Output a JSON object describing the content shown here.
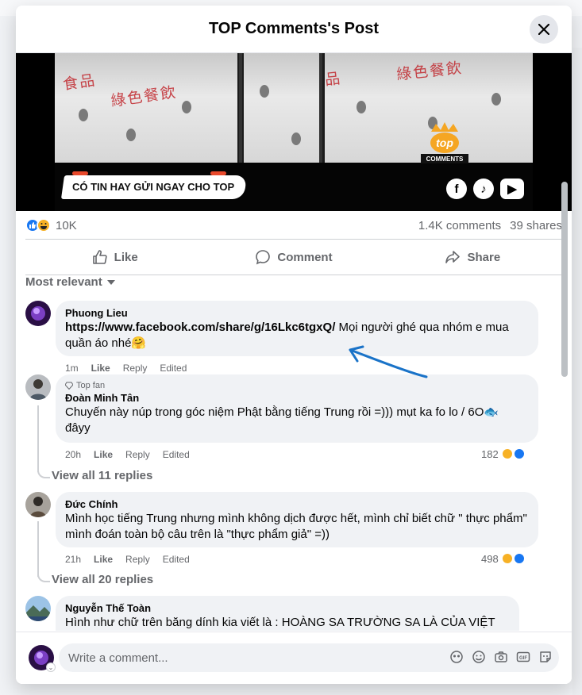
{
  "dialog": {
    "title": "TOP Comments's Post"
  },
  "video": {
    "banner_text": "CÓ TIN HAY GỬI NGAY CHO TOP",
    "overlay_chars": [
      "食品",
      "綠色餐飲",
      "品",
      "綠色餐飲"
    ],
    "logo_text": "COMMENTS",
    "logo_top": "top"
  },
  "stats": {
    "reaction_count": "10K",
    "comments": "1.4K comments",
    "shares": "39 shares"
  },
  "actions": {
    "like": "Like",
    "comment": "Comment",
    "share": "Share"
  },
  "sort": {
    "label": "Most relevant"
  },
  "comments": [
    {
      "name": "Phuong Lieu",
      "link": "https://www.facebook.com/share/g/16Lkc6tgxQ/",
      "text_line1": " Mọi người ghé qua nhóm e mua",
      "text_line2": "quần áo nhé",
      "emoji": "🤗",
      "time": "1m",
      "like": "Like",
      "reply": "Reply",
      "edited": "Edited"
    },
    {
      "badge": "Top fan",
      "name": "Đoàn Minh Tân",
      "text_line1": "Chuyến này núp trong góc niệm Phật bằng tiếng Trung rồi =))) mụt ka fo lo / 6O",
      "emoji": "🐟",
      "text_line2": "đâyy",
      "time": "20h",
      "like": "Like",
      "reply": "Reply",
      "edited": "Edited",
      "react_count": "182",
      "view_replies": "View all 11 replies"
    },
    {
      "name": "Đức Chính",
      "text_line1": "Mình học tiếng Trung nhưng mình không dịch được hết, mình chỉ biết chữ \" thực phẩm\"",
      "text_line2": "mình đoán toàn bộ câu trên là \"thực phẩm giả\" =))",
      "time": "21h",
      "like": "Like",
      "reply": "Reply",
      "edited": "Edited",
      "react_count": "498",
      "view_replies": "View all 20 replies"
    },
    {
      "name": "Nguyễn Thế Toàn",
      "text_line1": "Hình như chữ trên băng dính kia viết là : HOÀNG SA TRƯỜNG SA LÀ CỦA VIỆT NAM."
    }
  ],
  "composer": {
    "placeholder": "Write a comment..."
  },
  "colors": {
    "accent": "#1877f2",
    "arrow": "#1a73c8",
    "haha": "#f7b125"
  }
}
